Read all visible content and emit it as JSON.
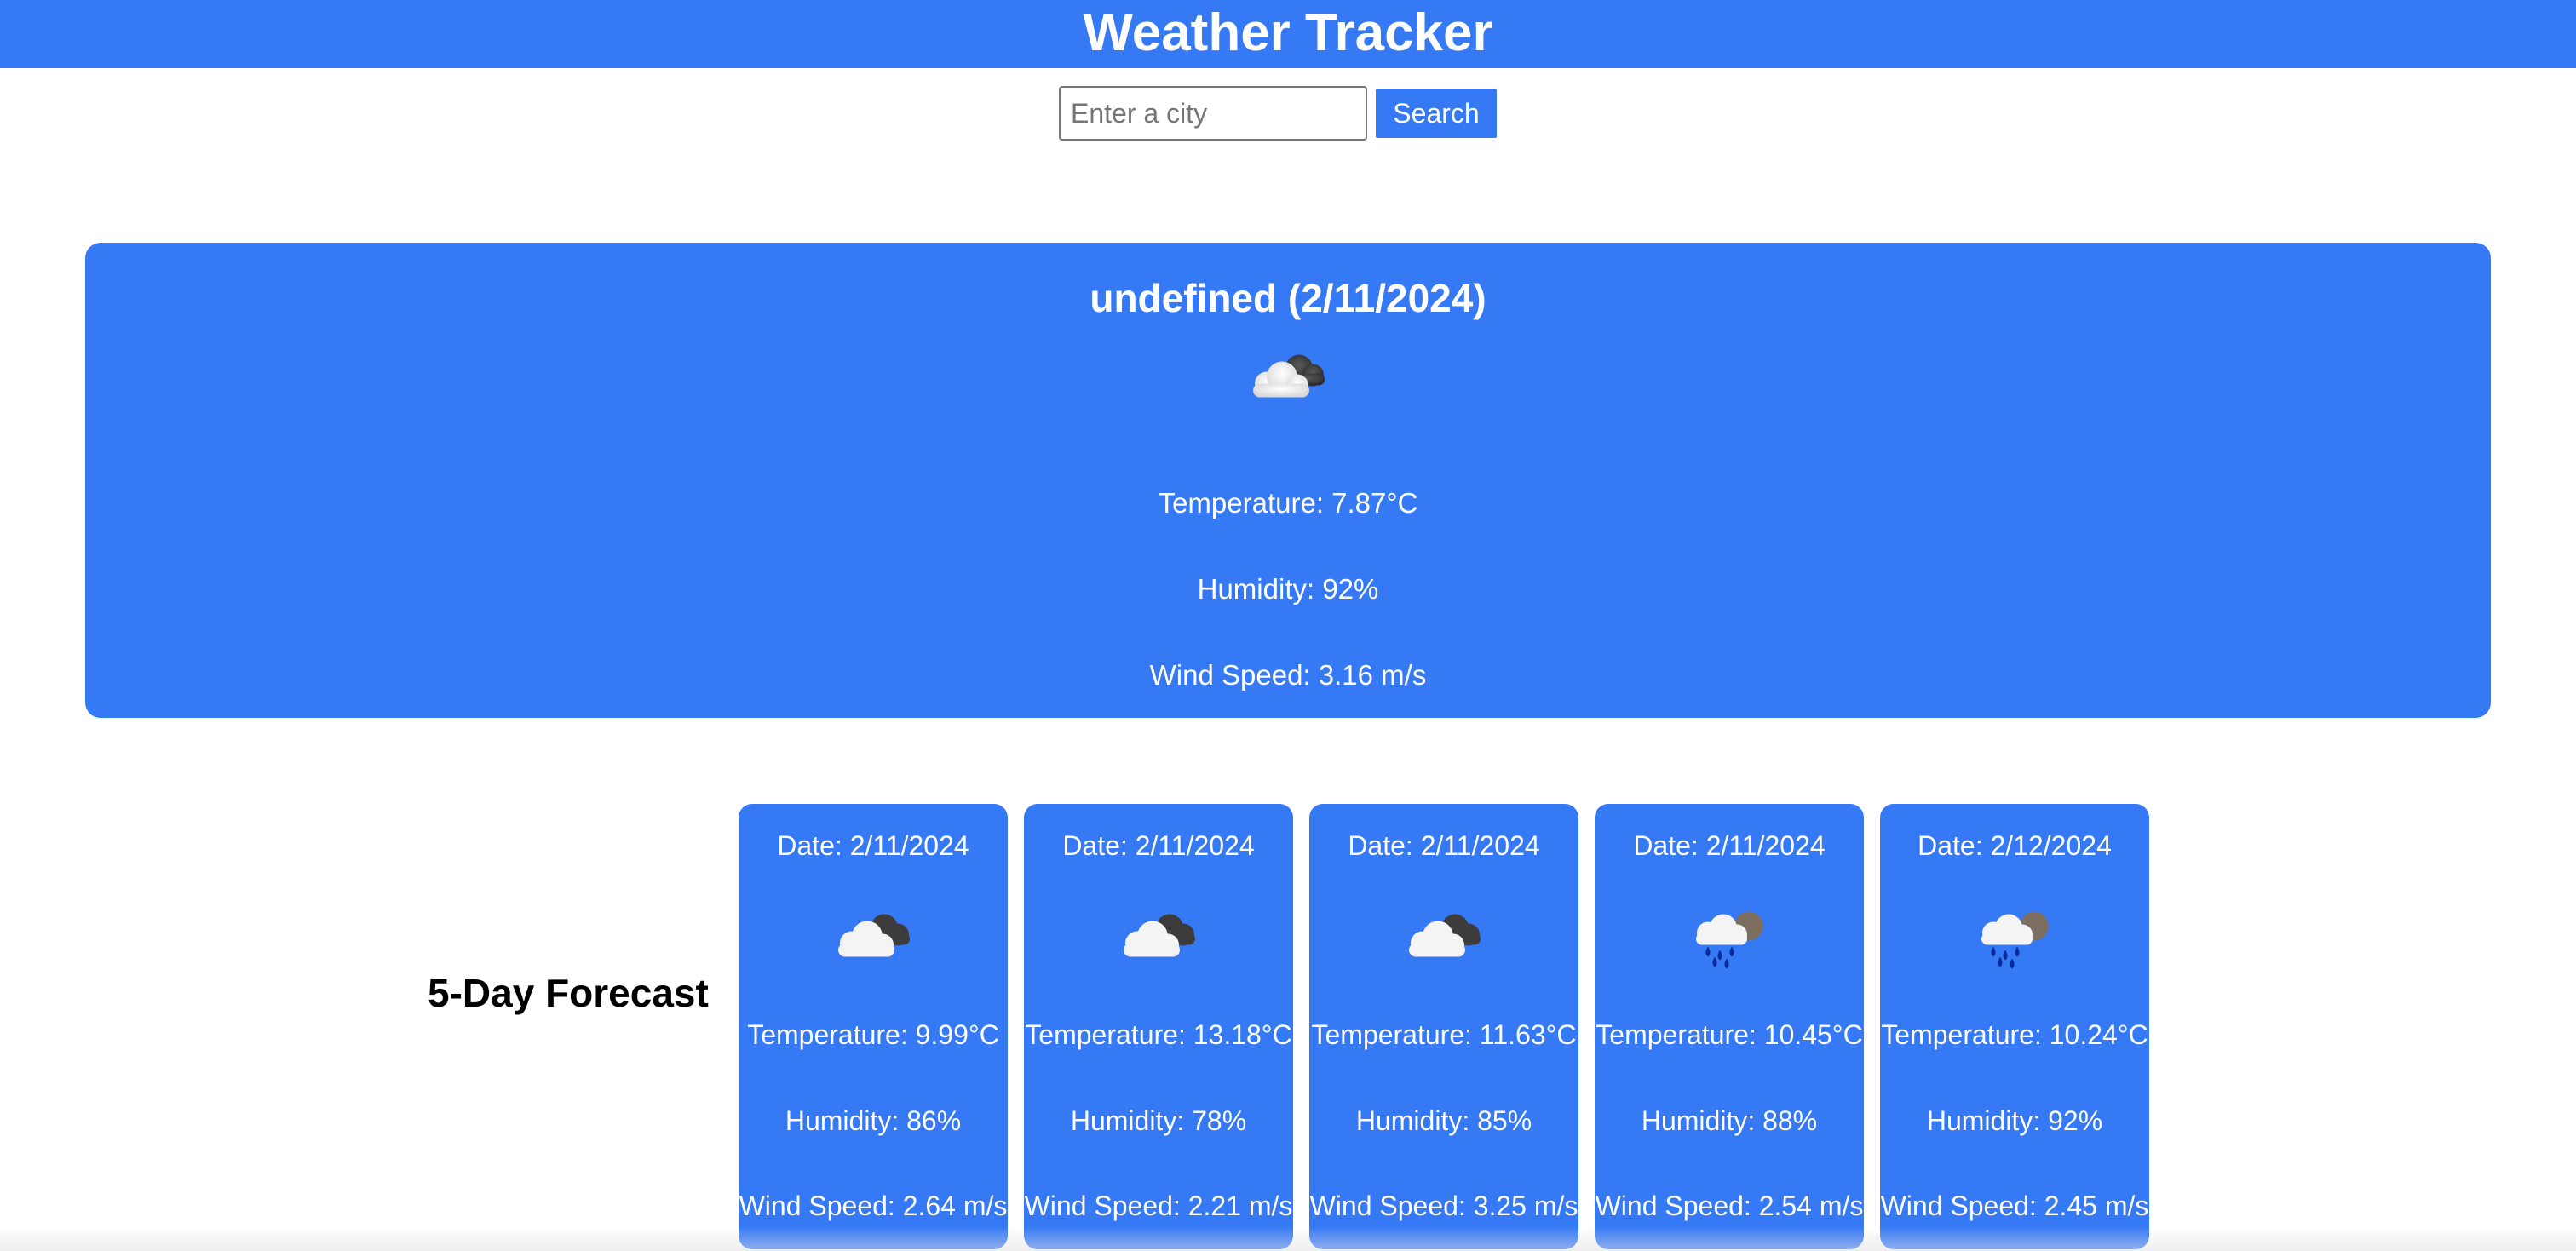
{
  "header": {
    "title": "Weather Tracker"
  },
  "search": {
    "placeholder": "Enter a city",
    "value": "",
    "button_label": "Search"
  },
  "current": {
    "title": "undefined (2/11/2024)",
    "icon": "cloudy-icon",
    "temperature": "Temperature: 7.87°C",
    "humidity": "Humidity: 92%",
    "wind": "Wind Speed: 3.16 m/s"
  },
  "forecast": {
    "heading": "5-Day Forecast",
    "days": [
      {
        "date": "Date: 2/11/2024",
        "icon": "cloudy-icon",
        "temperature": "Temperature: 9.99°C",
        "humidity": "Humidity: 86%",
        "wind": "Wind Speed: 2.64 m/s"
      },
      {
        "date": "Date: 2/11/2024",
        "icon": "cloudy-icon",
        "temperature": "Temperature: 13.18°C",
        "humidity": "Humidity: 78%",
        "wind": "Wind Speed: 2.21 m/s"
      },
      {
        "date": "Date: 2/11/2024",
        "icon": "cloudy-icon",
        "temperature": "Temperature: 11.63°C",
        "humidity": "Humidity: 85%",
        "wind": "Wind Speed: 3.25 m/s"
      },
      {
        "date": "Date: 2/11/2024",
        "icon": "rain-icon",
        "temperature": "Temperature: 10.45°C",
        "humidity": "Humidity: 88%",
        "wind": "Wind Speed: 2.54 m/s"
      },
      {
        "date": "Date: 2/12/2024",
        "icon": "rain-icon",
        "temperature": "Temperature: 10.24°C",
        "humidity": "Humidity: 92%",
        "wind": "Wind Speed: 2.45 m/s"
      }
    ]
  },
  "colors": {
    "accent": "#3679f5",
    "text_on_accent": "#ffffff",
    "heading_dark": "#000000"
  }
}
